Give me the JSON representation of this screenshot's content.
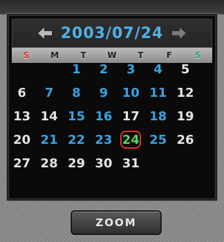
{
  "calendar": {
    "title": "2003/07/24",
    "prev_icon": "left-arrow-icon",
    "next_icon": "right-arrow-icon",
    "weekdays": [
      "S",
      "M",
      "T",
      "W",
      "T",
      "F",
      "S"
    ],
    "weekday_colors": [
      "#e0352a",
      "#222222",
      "#222222",
      "#222222",
      "#222222",
      "#222222",
      "#2a9a8a"
    ],
    "weeks": [
      [
        "",
        "",
        "1",
        "2",
        "3",
        "4",
        "5"
      ],
      [
        "6",
        "7",
        "8",
        "9",
        "10",
        "11",
        "12"
      ],
      [
        "13",
        "14",
        "15",
        "16",
        "17",
        "18",
        "19"
      ],
      [
        "20",
        "21",
        "22",
        "23",
        "24",
        "25",
        "26"
      ],
      [
        "27",
        "28",
        "29",
        "30",
        "31",
        "",
        ""
      ]
    ],
    "highlighted_days": [
      "1",
      "2",
      "3",
      "4",
      "7",
      "8",
      "9",
      "10",
      "11",
      "15",
      "16",
      "18",
      "21",
      "22",
      "23",
      "25"
    ],
    "selected_day": "24",
    "colors": {
      "highlight": "#3aa2e2",
      "selected_text": "#52d65a",
      "selected_ring": "#e0352a",
      "normal": "#e6e6e6"
    }
  },
  "zoom_button": {
    "label": "ZOOM"
  }
}
